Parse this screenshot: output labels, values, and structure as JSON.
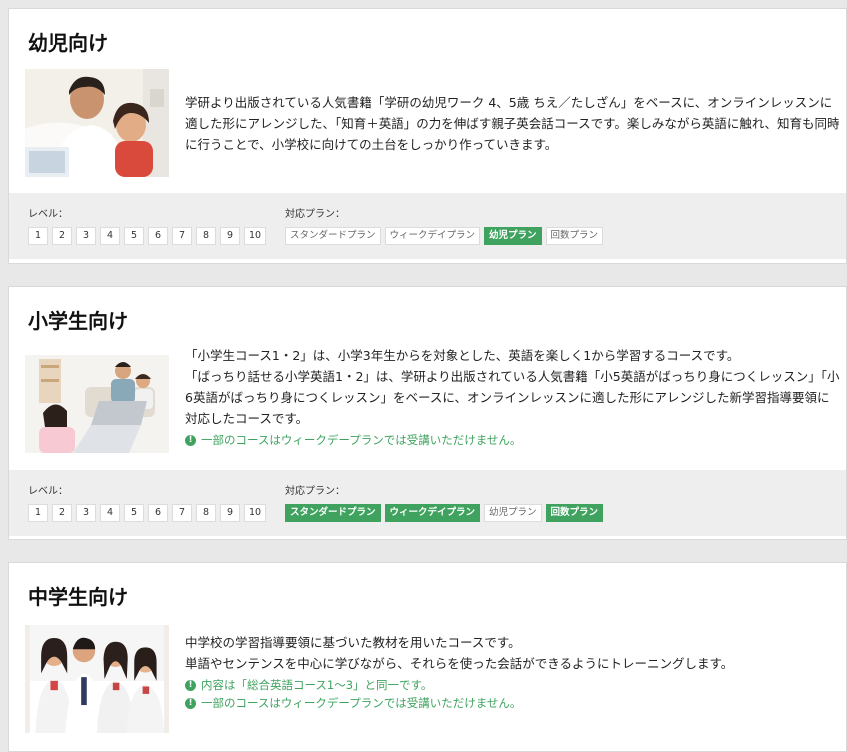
{
  "colors": {
    "accent": "#3fa35f",
    "panel_bg": "#eeeeee",
    "page_bg": "#e8e8e8"
  },
  "level_label": "レベル：",
  "plan_label": "対応プラン：",
  "levels": [
    "1",
    "2",
    "3",
    "4",
    "5",
    "6",
    "7",
    "8",
    "9",
    "10"
  ],
  "courses": [
    {
      "title": "幼児向け",
      "image": "parent-and-child-with-tablet-photo",
      "description": [
        "学研より出版されている人気書籍「学研の幼児ワーク 4、5歳 ちえ／たしざん」をベースに、オンラインレッスンに適した形にアレンジした、「知育＋英語」の力を伸ばす親子英会話コースです。楽しみながら英語に触れ、知育も同時に行うことで、小学校に向けての土台をしっかり作っていきます。"
      ],
      "notes": [],
      "plans": [
        {
          "label": "スタンダードプラン",
          "active": false
        },
        {
          "label": "ウィークデイプラン",
          "active": false
        },
        {
          "label": "幼児プラン",
          "active": true
        },
        {
          "label": "回数プラン",
          "active": false
        }
      ]
    },
    {
      "title": "小学生向け",
      "image": "family-with-laptop-photo",
      "description": [
        "「小学生コース1・2」は、小学3年生からを対象とした、英語を楽しく1から学習するコースです。",
        "「ばっちり話せる小学英語1・2」は、学研より出版されている人気書籍「小5英語がばっちり身につくレッスン」「小6英語がばっちり身につくレッスン」をベースに、オンラインレッスンに適した形にアレンジした新学習指導要領に対応したコースです。"
      ],
      "notes": [
        "一部のコースはウィークデープランでは受講いただけません。"
      ],
      "plans": [
        {
          "label": "スタンダードプラン",
          "active": true
        },
        {
          "label": "ウィークデイプラン",
          "active": true
        },
        {
          "label": "幼児プラン",
          "active": false
        },
        {
          "label": "回数プラン",
          "active": true
        }
      ]
    },
    {
      "title": "中学生向け",
      "image": "junior-high-students-group-photo",
      "description": [
        "中学校の学習指導要領に基づいた教材を用いたコースです。",
        "単語やセンテンスを中心に学びながら、それらを使った会話ができるようにトレーニングします。"
      ],
      "notes": [
        "内容は「総合英語コース1～3」と同一です。",
        "一部のコースはウィークデープランでは受講いただけません。"
      ],
      "plans": []
    }
  ]
}
